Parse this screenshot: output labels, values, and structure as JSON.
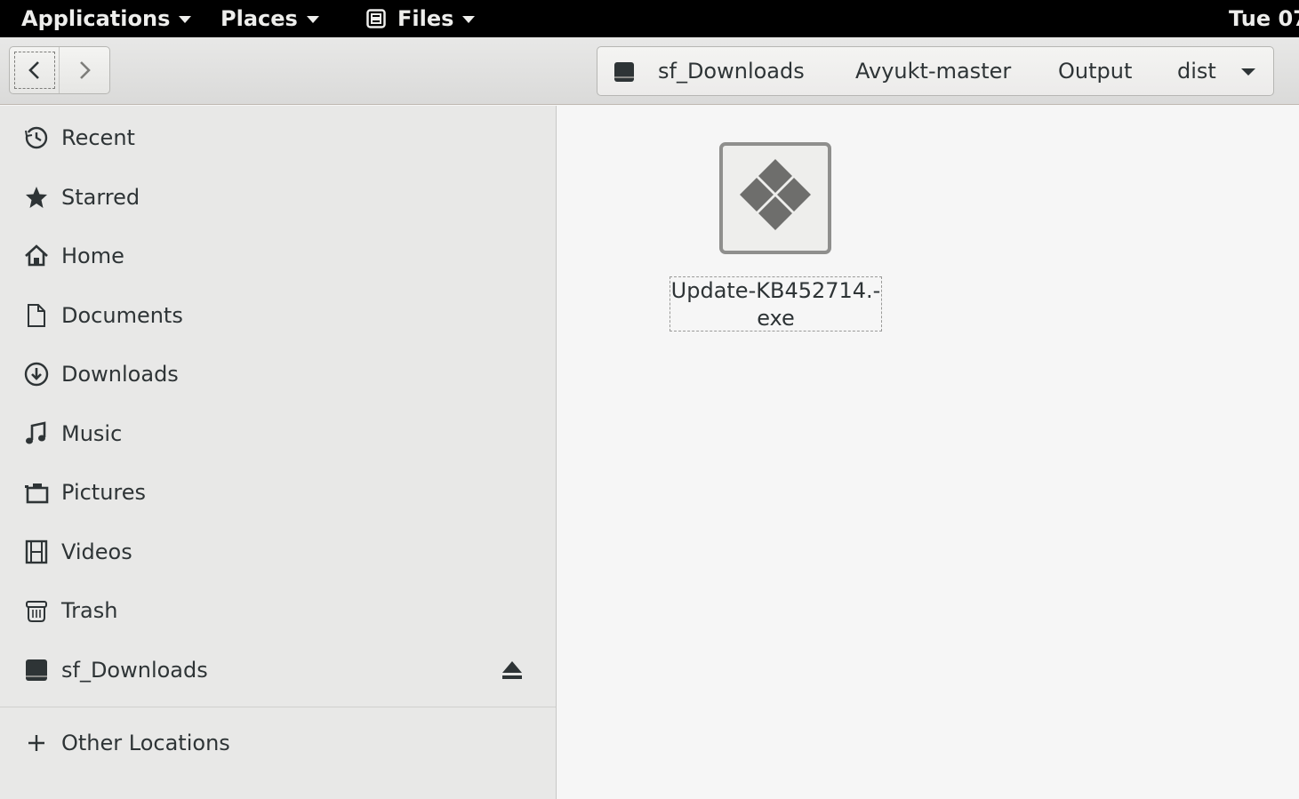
{
  "topbar": {
    "applications": "Applications",
    "places": "Places",
    "files": "Files",
    "clock": "Tue 07"
  },
  "pathbar": {
    "crumbs": [
      "sf_Downloads",
      "Avyukt-master",
      "Output",
      "dist"
    ]
  },
  "sidebar": {
    "items": [
      {
        "label": "Recent",
        "icon": "clock-icon"
      },
      {
        "label": "Starred",
        "icon": "star-icon"
      },
      {
        "label": "Home",
        "icon": "home-icon"
      },
      {
        "label": "Documents",
        "icon": "document-icon"
      },
      {
        "label": "Downloads",
        "icon": "download-icon"
      },
      {
        "label": "Music",
        "icon": "music-icon"
      },
      {
        "label": "Pictures",
        "icon": "camera-icon"
      },
      {
        "label": "Videos",
        "icon": "film-icon"
      },
      {
        "label": "Trash",
        "icon": "trash-icon"
      },
      {
        "label": "sf_Downloads",
        "icon": "drive-icon"
      }
    ],
    "other_locations": "Other Locations"
  },
  "files": [
    {
      "name_line1": "Update-KB452714.-",
      "name_line2": "exe",
      "icon": "executable-icon"
    }
  ]
}
